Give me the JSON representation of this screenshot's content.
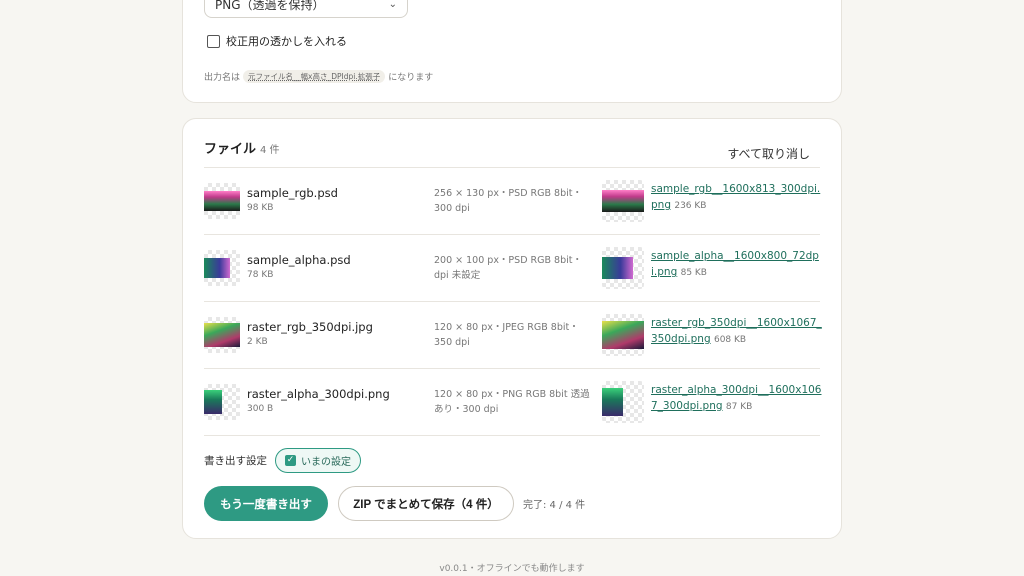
{
  "format_select": {
    "value": "PNG（透過を保持）"
  },
  "watermark": {
    "label": "校正用の透かしを入れる",
    "checked": false
  },
  "output_name_note": {
    "prefix": "出力名は",
    "pattern": "元ファイル名__幅x高さ_DPIdpi.拡張子",
    "suffix": "になります"
  },
  "files": {
    "title": "ファイル",
    "count": "4 件",
    "clear_all": "すべて取り消し",
    "items": [
      {
        "name": "sample_rgb.psd",
        "size": "98 KB",
        "meta": "256 × 130 px・PSD RGB 8bit・300 dpi",
        "output": "sample_rgb__1600x813_300dpi.png",
        "output_size": "236 KB"
      },
      {
        "name": "sample_alpha.psd",
        "size": "78 KB",
        "meta": "200 × 100 px・PSD RGB 8bit・dpi 未設定",
        "output": "sample_alpha__1600x800_72dpi.png",
        "output_size": "85 KB"
      },
      {
        "name": "raster_rgb_350dpi.jpg",
        "size": "2 KB",
        "meta": "120 × 80 px・JPEG RGB 8bit・350 dpi",
        "output": "raster_rgb_350dpi__1600x1067_350dpi.png",
        "output_size": "608 KB"
      },
      {
        "name": "raster_alpha_300dpi.png",
        "size": "300 B",
        "meta": "120 × 80 px・PNG RGB 8bit 透過あり・300 dpi",
        "output": "raster_alpha_300dpi__1600x1067_300dpi.png",
        "output_size": "87 KB"
      }
    ]
  },
  "export_settings": {
    "label": "書き出す設定",
    "chip": "いまの設定",
    "checked": true
  },
  "actions": {
    "reexport": "もう一度書き出す",
    "zip": "ZIP でまとめて保存（4 件）",
    "status": "完了: 4 / 4 件"
  },
  "footer": {
    "text": "v0.0.1・オフラインでも動作します"
  },
  "colors": {
    "accent": "#2e9a83",
    "link": "#1f6f5c",
    "background": "#f7f6f2"
  }
}
